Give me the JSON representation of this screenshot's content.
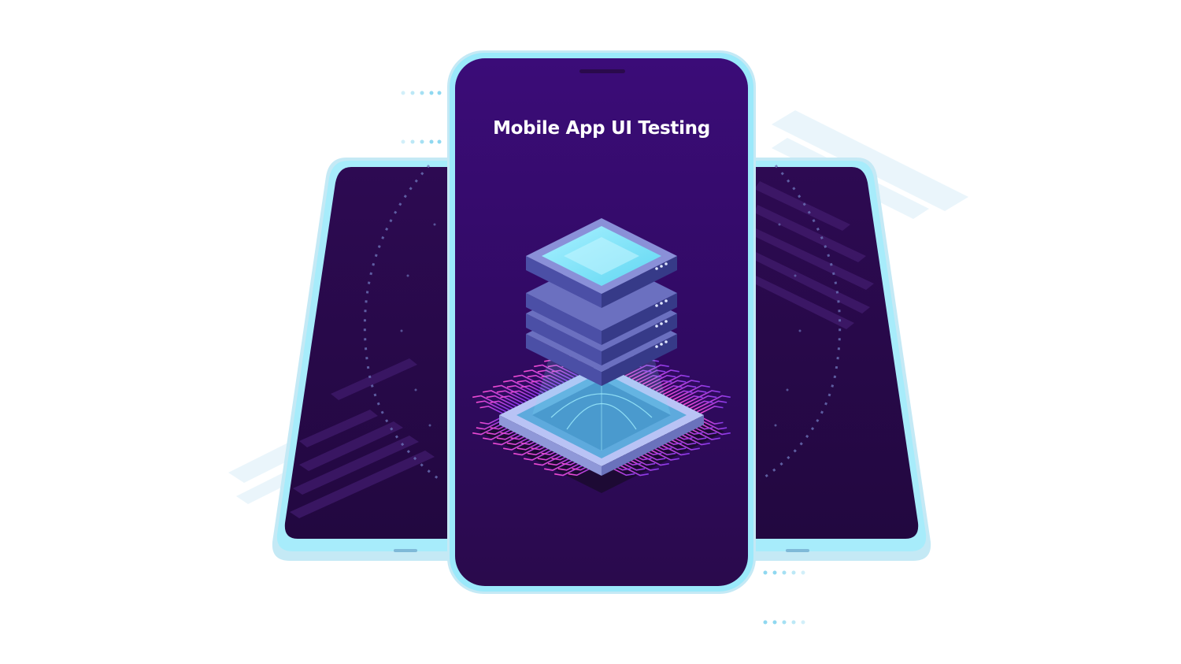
{
  "illustration": {
    "title": "Mobile App UI Testing",
    "icons": {
      "back_left_phone": "phone-icon",
      "back_right_phone": "phone-icon",
      "front_phone": "phone-icon",
      "server_stack": "server-stack-icon",
      "chip_base": "microchip-icon"
    },
    "colors": {
      "background": "#ffffff",
      "phone_frame": "#9be9fb",
      "phone_frame_dark": "#c4e9f5",
      "screen_top": "#3b0c78",
      "screen_bottom": "#2a0a4c",
      "server_cyan": "#7fe3f7",
      "server_lavender": "#6b6fc4",
      "circuit_pink": "#e040c8",
      "dot_blue": "#8fd8f0"
    }
  }
}
